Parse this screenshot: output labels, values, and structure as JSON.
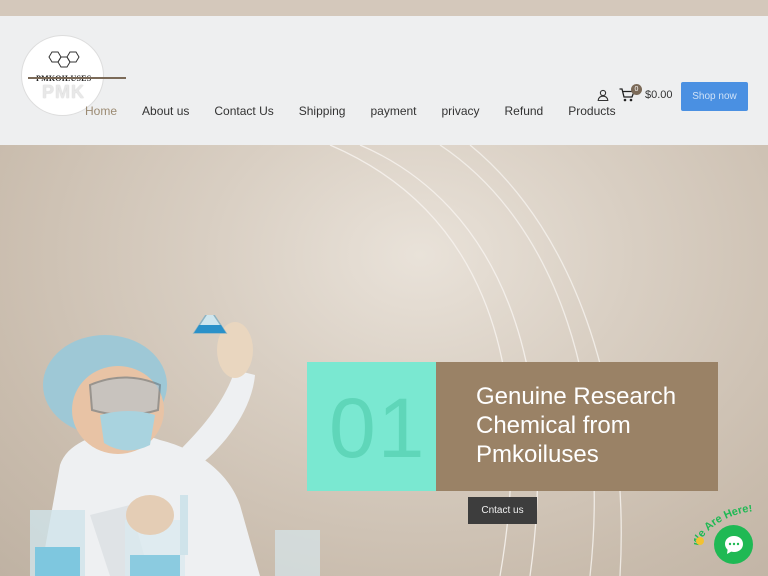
{
  "logo": {
    "text": "PMKOILUSES",
    "mark": "PMK"
  },
  "nav": {
    "items": [
      {
        "label": "Home",
        "active": true
      },
      {
        "label": "About us"
      },
      {
        "label": "Contact Us"
      },
      {
        "label": "Shipping"
      },
      {
        "label": "payment"
      },
      {
        "label": "privacy"
      },
      {
        "label": "Refund"
      },
      {
        "label": "Products"
      }
    ]
  },
  "header": {
    "user_icon": "user-icon",
    "cart_icon": "cart-icon",
    "cart_count": "0",
    "cart_total": "$0.00",
    "shop_button": "Shop now"
  },
  "hero": {
    "slide_number": "01",
    "title": "Genuine Research Chemical from Pmkoiluses",
    "cta": "Cntact us"
  },
  "chat": {
    "label": "We Are Here!",
    "icon": "chat-bubble-icon"
  },
  "colors": {
    "accent_teal": "#7ae8d1",
    "accent_brown": "#9a8266",
    "button_blue": "#4a90e2",
    "chat_green": "#1fb954"
  }
}
